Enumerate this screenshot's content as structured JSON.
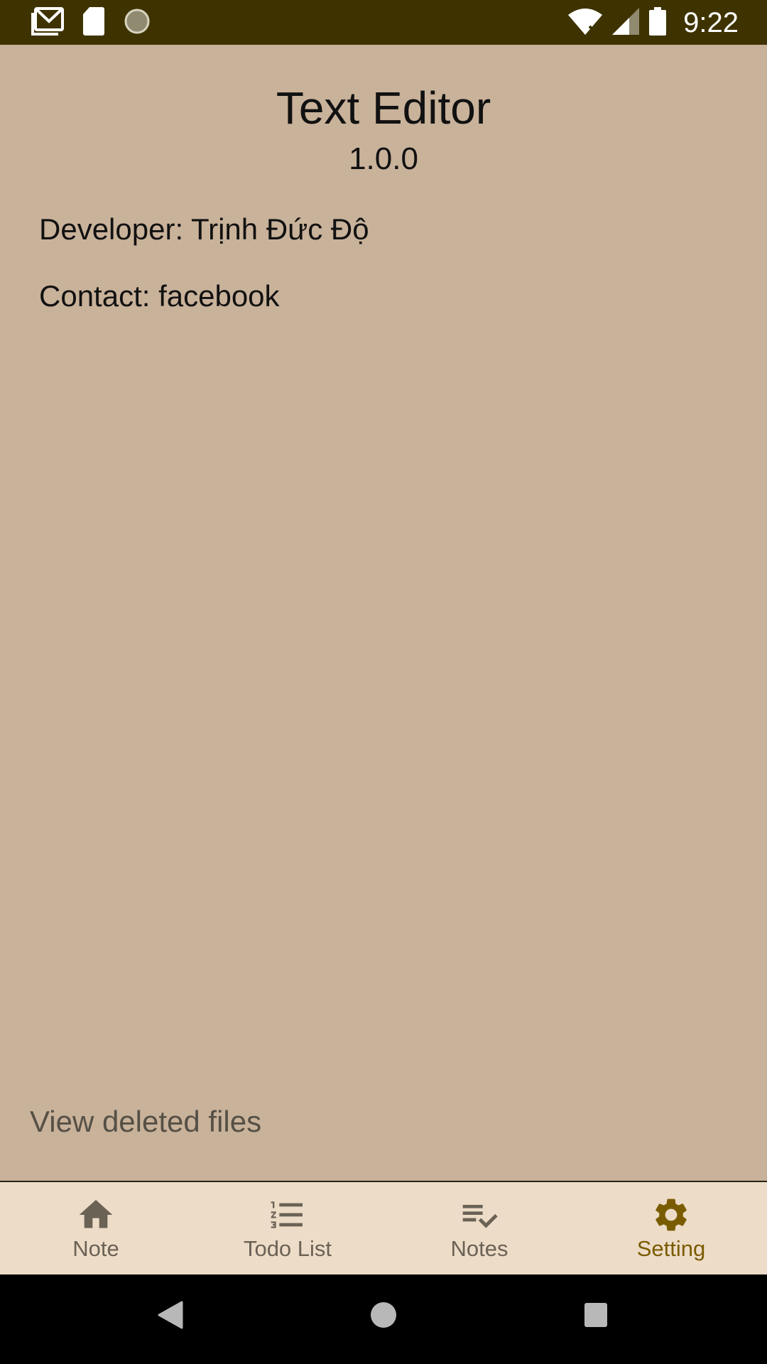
{
  "status_bar": {
    "time": "9:22",
    "icons": [
      "gmail-icon",
      "sd-card-icon",
      "sync-icon",
      "wifi-icon",
      "cell-signal-icon",
      "battery-icon"
    ]
  },
  "about": {
    "title": "Text Editor",
    "version": "1.0.0",
    "developer": "Developer: Trịnh Đức Độ",
    "contact": "Contact: facebook"
  },
  "footer_link": "View deleted files",
  "bottom_nav": {
    "items": [
      {
        "label": "Note",
        "icon": "home-icon",
        "active": false
      },
      {
        "label": "Todo List",
        "icon": "numbered-list-icon",
        "active": false
      },
      {
        "label": "Notes",
        "icon": "checklist-icon",
        "active": false
      },
      {
        "label": "Setting",
        "icon": "gear-icon",
        "active": true
      }
    ]
  },
  "system_nav": {
    "icons": [
      "back-icon",
      "home-circle-icon",
      "recents-icon"
    ]
  },
  "colors": {
    "status_bar": "#3e3300",
    "background": "#c9b29a",
    "nav_background": "#eddcc7",
    "active_accent": "#7a5c00",
    "inactive": "#6b6256"
  }
}
